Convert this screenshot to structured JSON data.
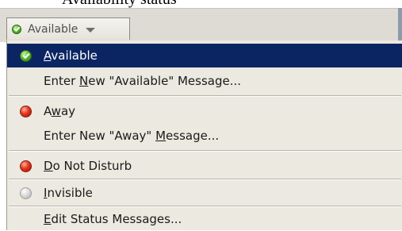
{
  "caption": "Availability status",
  "dropdown": {
    "label": "Available",
    "icon": "green-check-orb"
  },
  "menu": {
    "items": [
      {
        "label_pre": "",
        "mnemonic": "A",
        "label_post": "vailable",
        "icon": "green-check-orb",
        "selected": true
      },
      {
        "label_pre": "Enter ",
        "mnemonic": "N",
        "label_post": "ew \"Available\" Message...",
        "icon": "none",
        "selected": false
      },
      {
        "label_pre": "A",
        "mnemonic": "w",
        "label_post": "ay",
        "icon": "red-orb",
        "selected": false
      },
      {
        "label_pre": "Enter New \"Away\" ",
        "mnemonic": "M",
        "label_post": "essage...",
        "icon": "none",
        "selected": false
      },
      {
        "label_pre": "",
        "mnemonic": "D",
        "label_post": "o Not Disturb",
        "icon": "red-orb",
        "selected": false
      },
      {
        "label_pre": "",
        "mnemonic": "I",
        "label_post": "nvisible",
        "icon": "gray-orb",
        "selected": false
      },
      {
        "label_pre": "",
        "mnemonic": "E",
        "label_post": "dit Status Messages...",
        "icon": "none",
        "selected": false
      }
    ]
  },
  "colors": {
    "selection": "#0b2563",
    "menu_bg": "#ece9e1",
    "available": "#5dbd2e",
    "busy": "#e6361c",
    "invisible": "#d8d8d8"
  }
}
